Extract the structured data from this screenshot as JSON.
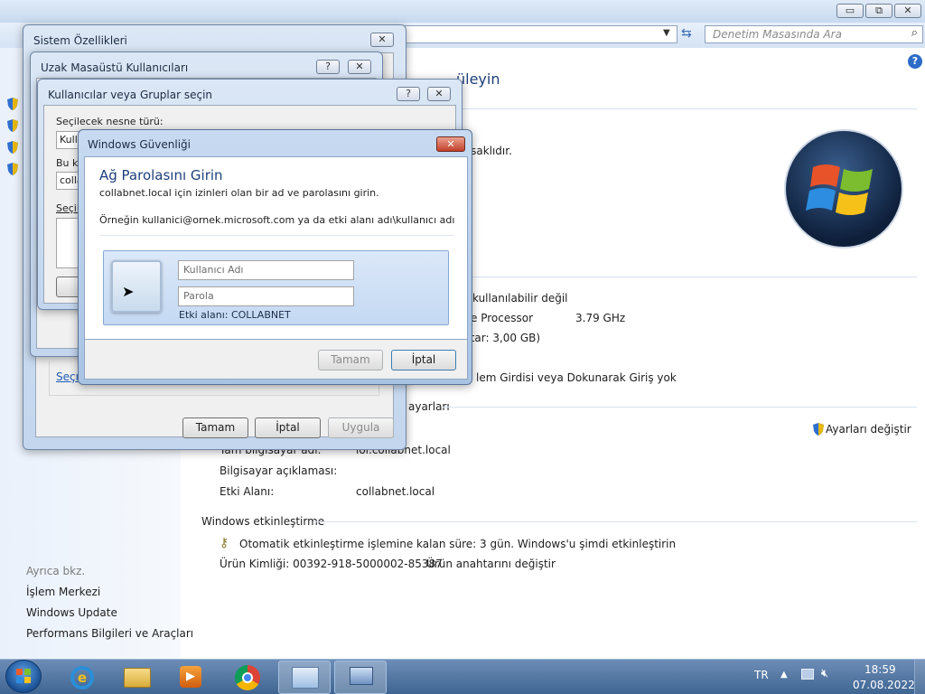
{
  "explorer": {
    "search_placeholder": "Denetim Masasında Ara",
    "heading_fragment": "üleyin",
    "window_buttons": {
      "minimize": "▭",
      "maximize": "⧉",
      "close": "✕"
    }
  },
  "control_panel": {
    "copyright_fragment": "rı saklıdır.",
    "rating": "kullanılabilir değil",
    "processor": "ore Processor",
    "processor_speed": "3.79 GHz",
    "ram": "ttar: 3,00 GB)",
    "pen_touch": "lem Girdisi veya Dokunarak Giriş yok",
    "section_computer_name": "ayarları",
    "change_settings": "Ayarları değiştir",
    "full_name_label": "Tam bilgisayar adı:",
    "full_name_value": "lol.collabnet.local",
    "description_label": "Bilgisayar açıklaması:",
    "domain_label": "Etki Alanı:",
    "domain_value": "collabnet.local",
    "activation_header": "Windows etkinleştirme",
    "activation_link": "Otomatik etkinleştirme işlemine kalan süre: 3 gün. Windows'u şimdi etkinleştirin",
    "product_id": "Ürün Kimliği:  00392-918-5000002-85387",
    "change_key": "Ürün anahtarını değiştir"
  },
  "sidebar": {
    "see_also": "Ayrıca bkz.",
    "links": [
      "İşlem Merkezi",
      "Windows Update",
      "Performans Bilgileri ve Araçları"
    ]
  },
  "system_properties": {
    "title": "Sistem Özellikleri",
    "link_fragment": "Seçm",
    "ok": "Tamam",
    "cancel": "İptal",
    "apply": "Uygula"
  },
  "remote_users": {
    "title": "Uzak Masaüstü Kullanıcıları"
  },
  "select_users": {
    "title": "Kullanıcılar veya Gruplar seçin",
    "object_type_label": "Seçilecek nesne türü:",
    "object_type_fragment": "Kulla",
    "location_label_fragment": "Bu ko",
    "location_fragment": "colla",
    "names_label_fragment": "Seçile"
  },
  "security_dialog": {
    "title": "Windows Güvenliği",
    "heading": "Ağ Parolasını Girin",
    "subtitle": "collabnet.local için izinleri olan bir ad ve parolasını girin.",
    "example": "Örneğin kullanici@ornek.microsoft.com  ya da  etki alanı adı\\kullanıcı adı",
    "username_placeholder": "Kullanıcı Adı",
    "password_placeholder": "Parola",
    "domain_line": "Etki alanı: COLLABNET",
    "ok": "Tamam",
    "cancel": "İptal"
  },
  "taskbar": {
    "language": "TR",
    "time": "18:59",
    "date": "07.08.2022"
  }
}
